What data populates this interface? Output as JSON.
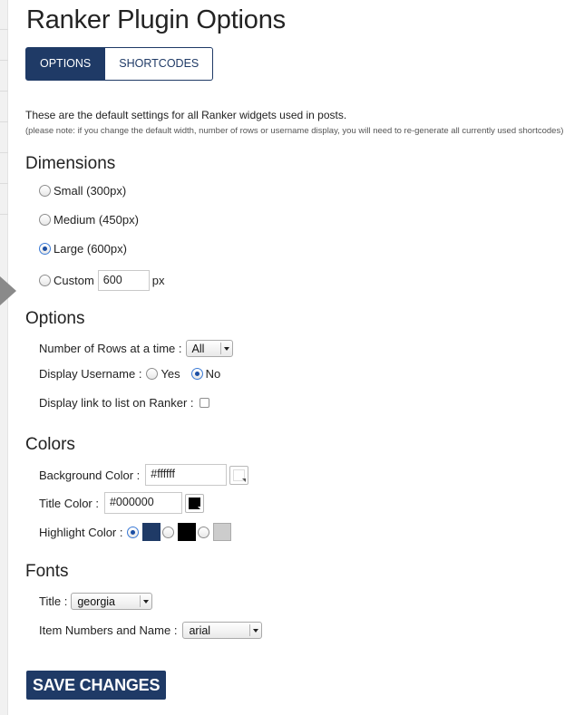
{
  "page": {
    "title": "Ranker Plugin Options"
  },
  "tabs": [
    {
      "label": "OPTIONS",
      "active": true
    },
    {
      "label": "SHORTCODES",
      "active": false
    }
  ],
  "intro": {
    "text": "These are the default settings for all Ranker widgets used in posts.",
    "note": "(please note: if you change the default width, number of rows or username display, you will need to re-generate all currently used shortcodes)"
  },
  "dimensions": {
    "heading": "Dimensions",
    "options": [
      {
        "label": "Small (300px)",
        "checked": false
      },
      {
        "label": "Medium (450px)",
        "checked": false
      },
      {
        "label": "Large (600px)",
        "checked": true
      },
      {
        "label": "Custom",
        "checked": false
      }
    ],
    "custom_value": "600",
    "custom_unit": "px"
  },
  "options": {
    "heading": "Options",
    "rows_label": "Number of Rows at a time :",
    "rows_value": "All",
    "username_label": "Display Username :",
    "username_yes": "Yes",
    "username_no": "No",
    "username_selected": "No",
    "link_label": "Display link to list on Ranker :",
    "link_checked": false
  },
  "colors": {
    "heading": "Colors",
    "background_label": "Background Color :",
    "background_value": "#ffffff",
    "title_label": "Title Color :",
    "title_value": "#000000",
    "highlight_label": "Highlight Color :",
    "highlight_options": [
      "#1f3a66",
      "#000000",
      "#cccccc"
    ],
    "highlight_selected": 0
  },
  "fonts": {
    "heading": "Fonts",
    "title_label": "Title :",
    "title_value": "georgia",
    "item_label": "Item Numbers and Name :",
    "item_value": "arial"
  },
  "save": {
    "label": "SAVE CHANGES"
  }
}
